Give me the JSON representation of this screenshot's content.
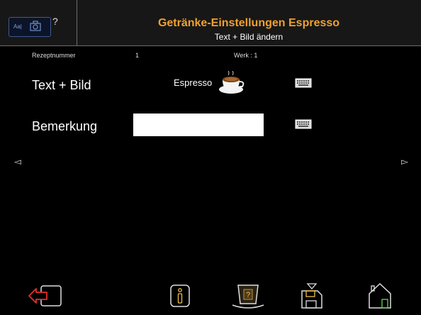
{
  "header": {
    "mode_text": "Aa|",
    "help": "?",
    "title": "Getränke-Einstellungen Espresso",
    "subtitle": "Text + Bild ändern"
  },
  "meta": {
    "recipe_label": "Rezeptnummer",
    "recipe_number": "1",
    "factory": "Werk : 1"
  },
  "rows": {
    "text_image_label": "Text + Bild",
    "drink_name": "Espresso",
    "remark_label": "Bemerkung",
    "remark_value": ""
  },
  "nav": {
    "prev": "◅",
    "next": "▻"
  },
  "colors": {
    "title": "#f0a030",
    "exit_icon": "#e03030",
    "accent": "#f0c040"
  }
}
